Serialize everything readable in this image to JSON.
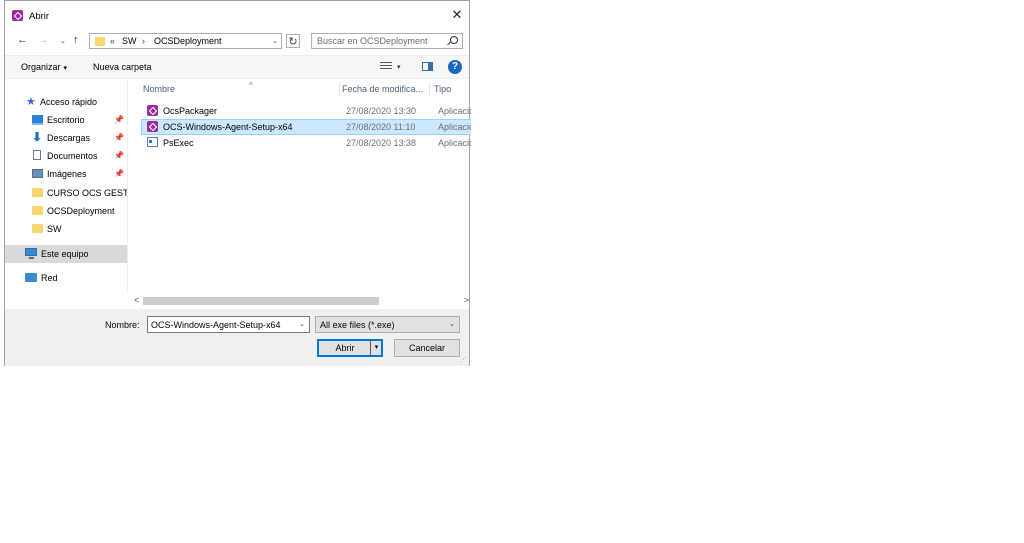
{
  "window": {
    "title": "Abrir",
    "close_glyph": "✕"
  },
  "nav": {
    "back_glyph": "←",
    "forward_glyph": "→",
    "recent_glyph": "⌄",
    "up_glyph": "↑",
    "address": {
      "prefix": "«",
      "sep": "›",
      "crumbs": [
        "SW",
        "OCSDeployment"
      ]
    },
    "refresh_glyph": "↻",
    "search_placeholder": "Buscar en OCSDeployment"
  },
  "toolbar": {
    "organize_label": "Organizar",
    "new_folder_label": "Nueva carpeta",
    "caret": "▾",
    "help_glyph": "?"
  },
  "sidebar": {
    "pin_glyph": "📌",
    "items": [
      {
        "label": "Acceso rápido",
        "icon": "star-icon",
        "pinned": false
      },
      {
        "label": "Escritorio",
        "icon": "desktop-icon",
        "pinned": true
      },
      {
        "label": "Descargas",
        "icon": "download-icon",
        "pinned": true
      },
      {
        "label": "Documentos",
        "icon": "document-icon",
        "pinned": true
      },
      {
        "label": "Imágenes",
        "icon": "pictures-icon",
        "pinned": true
      },
      {
        "label": "CURSO OCS GESTIO",
        "icon": "folder-icon",
        "pinned": false
      },
      {
        "label": "OCSDeployment",
        "icon": "folder-icon",
        "pinned": false
      },
      {
        "label": "SW",
        "icon": "folder-icon",
        "pinned": false
      },
      {
        "label": "Este equipo",
        "icon": "this-pc-icon",
        "selected": true
      },
      {
        "label": "Red",
        "icon": "network-icon"
      }
    ]
  },
  "filelist": {
    "columns": [
      "Nombre",
      "Fecha de modifica...",
      "Tipo"
    ],
    "sort_glyph": "^",
    "rows": [
      {
        "name": "OcsPackager",
        "date": "27/08/2020 13:30",
        "type": "Aplicació",
        "icon": "app-icon"
      },
      {
        "name": "OCS-Windows-Agent-Setup-x64",
        "date": "27/08/2020 11:10",
        "type": "Aplicació",
        "icon": "app-icon",
        "selected": true
      },
      {
        "name": "PsExec",
        "date": "27/08/2020 13:38",
        "type": "Aplicació",
        "icon": "exe-icon"
      }
    ]
  },
  "scroll": {
    "left_glyph": "<",
    "right_glyph": ">"
  },
  "bottom": {
    "name_label": "Nombre:",
    "name_value": "OCS-Windows-Agent-Setup-x64",
    "filter_value": "All exe files (*.exe)",
    "open_label": "Abrir",
    "cancel_label": "Cancelar",
    "drop_glyph": "⌄",
    "split_glyph": "▾",
    "grip_glyph": "⋰"
  },
  "colors": {
    "accent": "#0078d7",
    "selection": "#cce8ff",
    "help": "#1e64c4"
  }
}
